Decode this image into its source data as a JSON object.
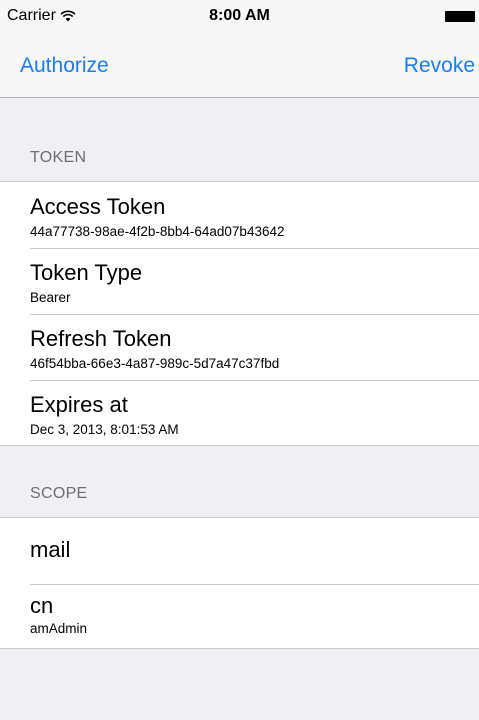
{
  "status_bar": {
    "carrier": "Carrier",
    "time": "8:00 AM",
    "wifi_icon": "wifi-icon",
    "battery_icon": "battery-icon"
  },
  "nav": {
    "left_label": "Authorize",
    "right_label": "Revoke",
    "tint_color": "#1a7cf8"
  },
  "token_section": {
    "header": "TOKEN",
    "rows": [
      {
        "title": "Access Token",
        "value": "44a77738-98ae-4f2b-8bb4-64ad07b43642"
      },
      {
        "title": "Token Type",
        "value": "Bearer"
      },
      {
        "title": "Refresh Token",
        "value": "46f54bba-66e3-4a87-989c-5d7a47c37fbd"
      },
      {
        "title": "Expires at",
        "value": "Dec 3, 2013, 8:01:53 AM"
      }
    ]
  },
  "scope_section": {
    "header": "SCOPE",
    "rows": [
      {
        "title": "mail",
        "value": ""
      },
      {
        "title": "cn",
        "value": "amAdmin"
      }
    ]
  },
  "colors": {
    "background": "#efeff4",
    "separator": "#c8c7cc",
    "section_header": "#6d6d72"
  }
}
